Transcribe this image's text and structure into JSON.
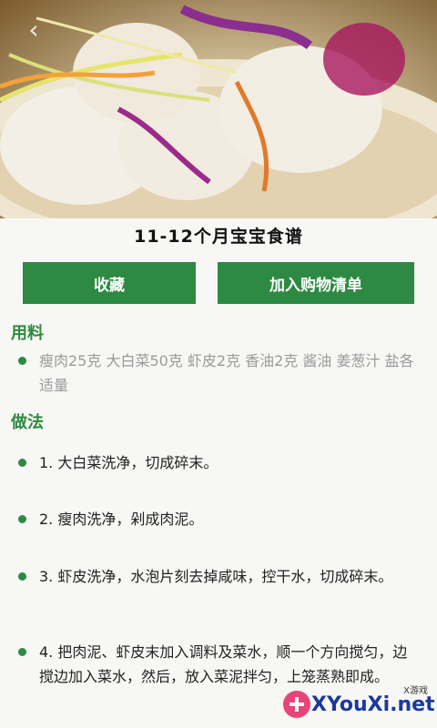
{
  "header": {
    "back_icon": "chevron-left-icon",
    "back_glyph": "‹"
  },
  "recipe": {
    "title": "11-12个月宝宝食谱"
  },
  "actions": {
    "favorite_label": "收藏",
    "add_to_list_label": "加入购物清单"
  },
  "ingredients": {
    "heading": "用料",
    "text": "瘦肉25克 大白菜50克 虾皮2克 香油2克 酱油 姜葱汁 盐各适量"
  },
  "method": {
    "heading": "做法",
    "steps": [
      "1. 大白菜洗净，切成碎末。",
      "2. 瘦肉洗净，剁成肉泥。",
      "3. 虾皮洗净，水泡片刻去掉咸味，控干水，切成碎末。",
      "4. 把肉泥、虾皮末加入调料及菜水，顺一个方向搅匀，边搅边加入菜水，然后，放入菜泥拌匀，上笼蒸熟即成。"
    ]
  },
  "watermark": {
    "small": "X游戏",
    "big": "XYouXi.net"
  },
  "colors": {
    "accent": "#2e8a42",
    "watermark_blue": "#1b3a9a"
  }
}
